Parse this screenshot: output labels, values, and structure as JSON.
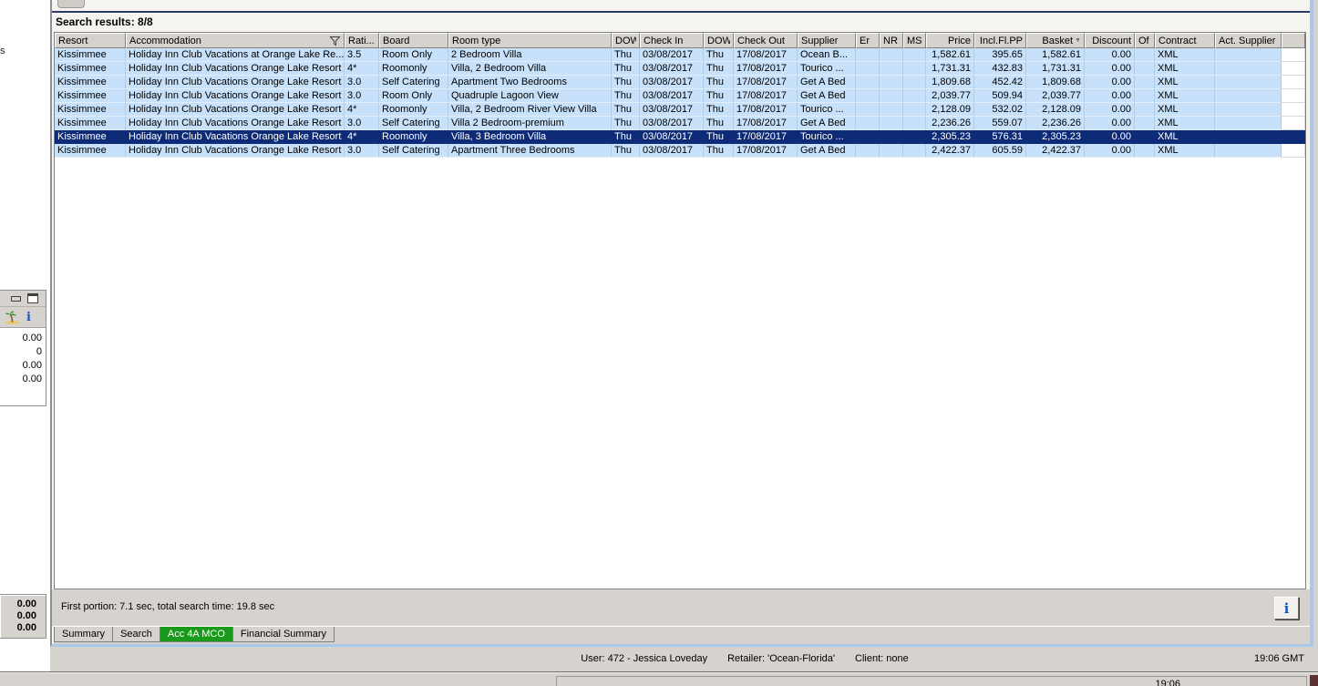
{
  "app": {
    "left_fragment": "s",
    "gmt_time": "19:06 GMT",
    "partial_time": "19:06"
  },
  "results_header": "Search results: 8/8",
  "table": {
    "columns": [
      {
        "label": "Resort"
      },
      {
        "label": "Accommodation",
        "icon": "filter-icon"
      },
      {
        "label": "Rati..."
      },
      {
        "label": "Board"
      },
      {
        "label": "Room type"
      },
      {
        "label": "DOW"
      },
      {
        "label": "Check In"
      },
      {
        "label": "DOW"
      },
      {
        "label": "Check Out"
      },
      {
        "label": "Supplier"
      },
      {
        "label": "Er"
      },
      {
        "label": "NR"
      },
      {
        "label": "MS"
      },
      {
        "label": "Price"
      },
      {
        "label": "Incl.Fl.PP"
      },
      {
        "label": "Basket",
        "icon": "sort-icon"
      },
      {
        "label": "Discount"
      },
      {
        "label": "Of"
      },
      {
        "label": "Contract"
      },
      {
        "label": "Act. Supplier"
      },
      {
        "label": ""
      }
    ],
    "selected_row_index": 6,
    "rows": [
      [
        "Kissimmee",
        "Holiday Inn Club Vacations at Orange Lake Re...",
        "3.5",
        "Room Only",
        "2 Bedroom Villa",
        "Thu",
        "03/08/2017",
        "Thu",
        "17/08/2017",
        "Ocean B...",
        "",
        "",
        "",
        "1,582.61",
        "395.65",
        "1,582.61",
        "0.00",
        "",
        "XML",
        "",
        ""
      ],
      [
        "Kissimmee",
        "Holiday Inn Club Vacations Orange Lake Resort",
        "4*",
        "Roomonly",
        "Villa, 2 Bedroom Villa",
        "Thu",
        "03/08/2017",
        "Thu",
        "17/08/2017",
        "Tourico ...",
        "",
        "",
        "",
        "1,731.31",
        "432.83",
        "1,731.31",
        "0.00",
        "",
        "XML",
        "",
        ""
      ],
      [
        "Kissimmee",
        "Holiday Inn Club Vacations Orange Lake Resort",
        "3.0",
        "Self Catering",
        "Apartment Two Bedrooms",
        "Thu",
        "03/08/2017",
        "Thu",
        "17/08/2017",
        "Get A Bed",
        "",
        "",
        "",
        "1,809.68",
        "452.42",
        "1,809.68",
        "0.00",
        "",
        "XML",
        "",
        ""
      ],
      [
        "Kissimmee",
        "Holiday Inn Club Vacations Orange Lake Resort",
        "3.0",
        "Room Only",
        "Quadruple Lagoon View",
        "Thu",
        "03/08/2017",
        "Thu",
        "17/08/2017",
        "Get A Bed",
        "",
        "",
        "",
        "2,039.77",
        "509.94",
        "2,039.77",
        "0.00",
        "",
        "XML",
        "",
        ""
      ],
      [
        "Kissimmee",
        "Holiday Inn Club Vacations Orange Lake Resort",
        "4*",
        "Roomonly",
        "Villa, 2 Bedroom River View Villa",
        "Thu",
        "03/08/2017",
        "Thu",
        "17/08/2017",
        "Tourico ...",
        "",
        "",
        "",
        "2,128.09",
        "532.02",
        "2,128.09",
        "0.00",
        "",
        "XML",
        "",
        ""
      ],
      [
        "Kissimmee",
        "Holiday Inn Club Vacations Orange Lake Resort",
        "3.0",
        "Self Catering",
        "Villa 2 Bedroom-premium",
        "Thu",
        "03/08/2017",
        "Thu",
        "17/08/2017",
        "Get A Bed",
        "",
        "",
        "",
        "2,236.26",
        "559.07",
        "2,236.26",
        "0.00",
        "",
        "XML",
        "",
        ""
      ],
      [
        "Kissimmee",
        "Holiday Inn Club Vacations Orange Lake Resort",
        "4*",
        "Roomonly",
        "Villa, 3 Bedroom Villa",
        "Thu",
        "03/08/2017",
        "Thu",
        "17/08/2017",
        "Tourico ...",
        "",
        "",
        "",
        "2,305.23",
        "576.31",
        "2,305.23",
        "0.00",
        "",
        "XML",
        "",
        ""
      ],
      [
        "Kissimmee",
        "Holiday Inn Club Vacations Orange Lake Resort",
        "3.0",
        "Self Catering",
        "Apartment Three Bedrooms",
        "Thu",
        "03/08/2017",
        "Thu",
        "17/08/2017",
        "Get A Bed",
        "",
        "",
        "",
        "2,422.37",
        "605.59",
        "2,422.37",
        "0.00",
        "",
        "XML",
        "",
        ""
      ]
    ]
  },
  "side_panel": {
    "values": [
      "0.00",
      "0",
      "0.00",
      "0.00"
    ],
    "info_glyph": "i"
  },
  "bottom_left_panel": {
    "values": [
      "0.00",
      "0.00",
      "0.00"
    ]
  },
  "status": {
    "first_portion": "First portion: 7.1 sec, total search time: 19.8 sec",
    "info_glyph": "i"
  },
  "tabs": [
    {
      "label": "Summary",
      "active": false
    },
    {
      "label": "Search",
      "active": false
    },
    {
      "label": "Acc 4A MCO",
      "active": true
    },
    {
      "label": "Financial Summary",
      "active": false
    }
  ],
  "statusbar": {
    "user": "User: 472 - Jessica Loveday",
    "retailer": "Retailer: 'Ocean-Florida'",
    "client": "Client: none"
  },
  "colors": {
    "row_blue": "#c7e1fa",
    "selection_navy": "#0e2b78",
    "active_tab_green": "#1a9a1a",
    "frame_blue": "#aac8e8",
    "chrome_gray": "#d6d3ce"
  }
}
